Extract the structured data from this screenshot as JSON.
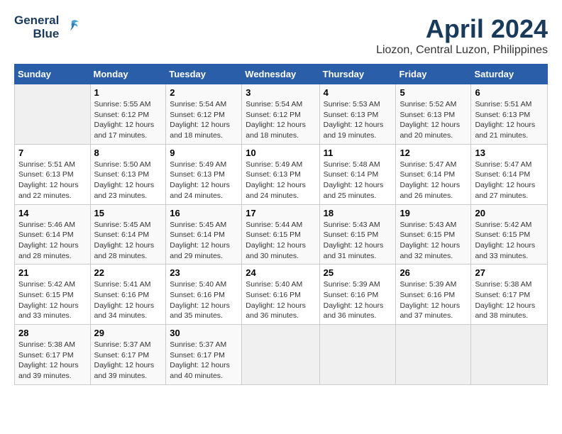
{
  "header": {
    "logo_line1": "General",
    "logo_line2": "Blue",
    "title": "April 2024",
    "subtitle": "Liozon, Central Luzon, Philippines"
  },
  "calendar": {
    "days_of_week": [
      "Sunday",
      "Monday",
      "Tuesday",
      "Wednesday",
      "Thursday",
      "Friday",
      "Saturday"
    ],
    "weeks": [
      [
        {
          "day": "",
          "info": ""
        },
        {
          "day": "1",
          "info": "Sunrise: 5:55 AM\nSunset: 6:12 PM\nDaylight: 12 hours\nand 17 minutes."
        },
        {
          "day": "2",
          "info": "Sunrise: 5:54 AM\nSunset: 6:12 PM\nDaylight: 12 hours\nand 18 minutes."
        },
        {
          "day": "3",
          "info": "Sunrise: 5:54 AM\nSunset: 6:12 PM\nDaylight: 12 hours\nand 18 minutes."
        },
        {
          "day": "4",
          "info": "Sunrise: 5:53 AM\nSunset: 6:13 PM\nDaylight: 12 hours\nand 19 minutes."
        },
        {
          "day": "5",
          "info": "Sunrise: 5:52 AM\nSunset: 6:13 PM\nDaylight: 12 hours\nand 20 minutes."
        },
        {
          "day": "6",
          "info": "Sunrise: 5:51 AM\nSunset: 6:13 PM\nDaylight: 12 hours\nand 21 minutes."
        }
      ],
      [
        {
          "day": "7",
          "info": "Sunrise: 5:51 AM\nSunset: 6:13 PM\nDaylight: 12 hours\nand 22 minutes."
        },
        {
          "day": "8",
          "info": "Sunrise: 5:50 AM\nSunset: 6:13 PM\nDaylight: 12 hours\nand 23 minutes."
        },
        {
          "day": "9",
          "info": "Sunrise: 5:49 AM\nSunset: 6:13 PM\nDaylight: 12 hours\nand 24 minutes."
        },
        {
          "day": "10",
          "info": "Sunrise: 5:49 AM\nSunset: 6:13 PM\nDaylight: 12 hours\nand 24 minutes."
        },
        {
          "day": "11",
          "info": "Sunrise: 5:48 AM\nSunset: 6:14 PM\nDaylight: 12 hours\nand 25 minutes."
        },
        {
          "day": "12",
          "info": "Sunrise: 5:47 AM\nSunset: 6:14 PM\nDaylight: 12 hours\nand 26 minutes."
        },
        {
          "day": "13",
          "info": "Sunrise: 5:47 AM\nSunset: 6:14 PM\nDaylight: 12 hours\nand 27 minutes."
        }
      ],
      [
        {
          "day": "14",
          "info": "Sunrise: 5:46 AM\nSunset: 6:14 PM\nDaylight: 12 hours\nand 28 minutes."
        },
        {
          "day": "15",
          "info": "Sunrise: 5:45 AM\nSunset: 6:14 PM\nDaylight: 12 hours\nand 28 minutes."
        },
        {
          "day": "16",
          "info": "Sunrise: 5:45 AM\nSunset: 6:14 PM\nDaylight: 12 hours\nand 29 minutes."
        },
        {
          "day": "17",
          "info": "Sunrise: 5:44 AM\nSunset: 6:15 PM\nDaylight: 12 hours\nand 30 minutes."
        },
        {
          "day": "18",
          "info": "Sunrise: 5:43 AM\nSunset: 6:15 PM\nDaylight: 12 hours\nand 31 minutes."
        },
        {
          "day": "19",
          "info": "Sunrise: 5:43 AM\nSunset: 6:15 PM\nDaylight: 12 hours\nand 32 minutes."
        },
        {
          "day": "20",
          "info": "Sunrise: 5:42 AM\nSunset: 6:15 PM\nDaylight: 12 hours\nand 33 minutes."
        }
      ],
      [
        {
          "day": "21",
          "info": "Sunrise: 5:42 AM\nSunset: 6:15 PM\nDaylight: 12 hours\nand 33 minutes."
        },
        {
          "day": "22",
          "info": "Sunrise: 5:41 AM\nSunset: 6:16 PM\nDaylight: 12 hours\nand 34 minutes."
        },
        {
          "day": "23",
          "info": "Sunrise: 5:40 AM\nSunset: 6:16 PM\nDaylight: 12 hours\nand 35 minutes."
        },
        {
          "day": "24",
          "info": "Sunrise: 5:40 AM\nSunset: 6:16 PM\nDaylight: 12 hours\nand 36 minutes."
        },
        {
          "day": "25",
          "info": "Sunrise: 5:39 AM\nSunset: 6:16 PM\nDaylight: 12 hours\nand 36 minutes."
        },
        {
          "day": "26",
          "info": "Sunrise: 5:39 AM\nSunset: 6:16 PM\nDaylight: 12 hours\nand 37 minutes."
        },
        {
          "day": "27",
          "info": "Sunrise: 5:38 AM\nSunset: 6:17 PM\nDaylight: 12 hours\nand 38 minutes."
        }
      ],
      [
        {
          "day": "28",
          "info": "Sunrise: 5:38 AM\nSunset: 6:17 PM\nDaylight: 12 hours\nand 39 minutes."
        },
        {
          "day": "29",
          "info": "Sunrise: 5:37 AM\nSunset: 6:17 PM\nDaylight: 12 hours\nand 39 minutes."
        },
        {
          "day": "30",
          "info": "Sunrise: 5:37 AM\nSunset: 6:17 PM\nDaylight: 12 hours\nand 40 minutes."
        },
        {
          "day": "",
          "info": ""
        },
        {
          "day": "",
          "info": ""
        },
        {
          "day": "",
          "info": ""
        },
        {
          "day": "",
          "info": ""
        }
      ]
    ]
  }
}
